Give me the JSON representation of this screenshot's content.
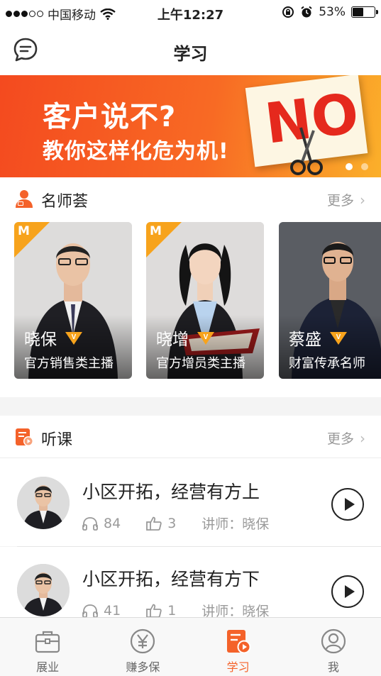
{
  "status_bar": {
    "carrier": "中国移动",
    "time": "上午12:27",
    "battery": "53%",
    "battery_level": 0.53
  },
  "nav": {
    "title": "学习"
  },
  "banner": {
    "line1": "客户说不?",
    "line2": "教你这样化危为机!",
    "sign_text": "NO",
    "page_count": 2,
    "active_page": 1
  },
  "masters": {
    "title": "名师荟",
    "more": "更多",
    "teachers": [
      {
        "name": "晓保",
        "role": "官方销售类主播",
        "badge": "M"
      },
      {
        "name": "晓增",
        "role": "官方增员类主播",
        "badge": "M"
      },
      {
        "name": "蔡盛",
        "role": "财富传承名师",
        "badge": ""
      }
    ]
  },
  "courses": {
    "title": "听课",
    "more": "更多",
    "items": [
      {
        "title": "小区开拓，经营有方上",
        "listens": "84",
        "likes": "3",
        "lecturer": "讲师：晓保"
      },
      {
        "title": "小区开拓，经营有方下",
        "listens": "41",
        "likes": "1",
        "lecturer": "讲师：晓保"
      }
    ]
  },
  "tabs": [
    {
      "label": "展业",
      "icon": "briefcase-icon"
    },
    {
      "label": "赚多保",
      "icon": "yen-icon"
    },
    {
      "label": "学习",
      "icon": "study-icon"
    },
    {
      "label": "我",
      "icon": "user-icon"
    }
  ],
  "colors": {
    "accent": "#f4622a",
    "badge": "#f7a31c"
  }
}
